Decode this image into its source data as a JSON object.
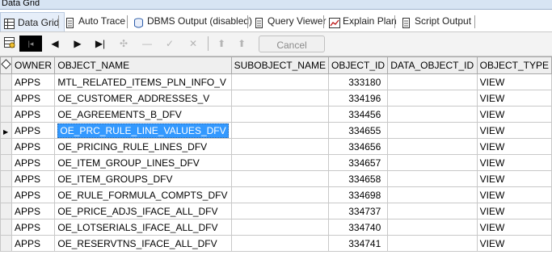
{
  "window": {
    "title": "Data Grid"
  },
  "tabs": [
    {
      "label": "Data Grid",
      "icon": "grid-icon"
    },
    {
      "label": "Auto Trace",
      "icon": "document-icon"
    },
    {
      "label": "DBMS Output (disabled)",
      "icon": "dbms-icon"
    },
    {
      "label": "Query Viewer",
      "icon": "document-icon"
    },
    {
      "label": "Explain Plan",
      "icon": "explain-plan-icon"
    },
    {
      "label": "Script Output",
      "icon": "document-icon"
    }
  ],
  "toolbar": {
    "cancel_label": "Cancel"
  },
  "columns": [
    "OWNER",
    "OBJECT_NAME",
    "SUBOBJECT_NAME",
    "OBJECT_ID",
    "DATA_OBJECT_ID",
    "OBJECT_TYPE"
  ],
  "rows": [
    [
      "APPS",
      "MTL_RELATED_ITEMS_PLN_INFO_V",
      "",
      "333180",
      "",
      "VIEW"
    ],
    [
      "APPS",
      "OE_CUSTOMER_ADDRESSES_V",
      "",
      "334196",
      "",
      "VIEW"
    ],
    [
      "APPS",
      "OE_AGREEMENTS_B_DFV",
      "",
      "334456",
      "",
      "VIEW"
    ],
    [
      "APPS",
      "OE_PRC_RULE_LINE_VALUES_DFV",
      "",
      "334655",
      "",
      "VIEW"
    ],
    [
      "APPS",
      "OE_PRICING_RULE_LINES_DFV",
      "",
      "334656",
      "",
      "VIEW"
    ],
    [
      "APPS",
      "OE_ITEM_GROUP_LINES_DFV",
      "",
      "334657",
      "",
      "VIEW"
    ],
    [
      "APPS",
      "OE_ITEM_GROUPS_DFV",
      "",
      "334658",
      "",
      "VIEW"
    ],
    [
      "APPS",
      "OE_RULE_FORMULA_COMPTS_DFV",
      "",
      "334698",
      "",
      "VIEW"
    ],
    [
      "APPS",
      "OE_PRICE_ADJS_IFACE_ALL_DFV",
      "",
      "334737",
      "",
      "VIEW"
    ],
    [
      "APPS",
      "OE_LOTSERIALS_IFACE_ALL_DFV",
      "",
      "334740",
      "",
      "VIEW"
    ],
    [
      "APPS",
      "OE_RESERVTNS_IFACE_ALL_DFV",
      "",
      "334741",
      "",
      "VIEW"
    ]
  ],
  "selected_row": 3
}
